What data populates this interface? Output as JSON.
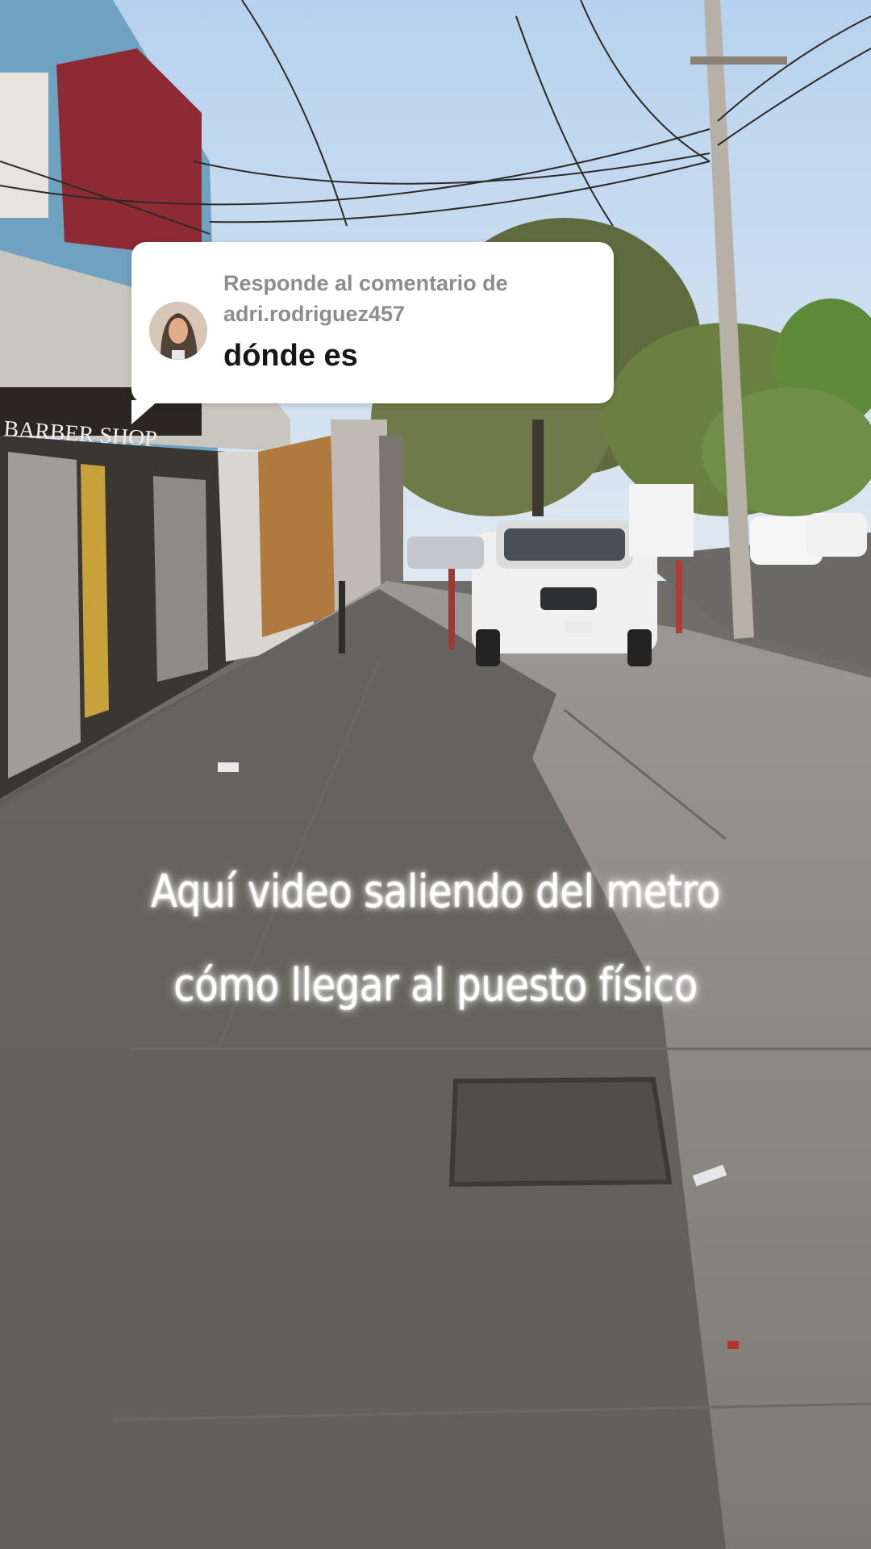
{
  "reply": {
    "header_line1": "Responde al comentario de",
    "header_line2": "adri.rodriguez457",
    "comment_text": "dónde es"
  },
  "caption": {
    "line1": "Aquí video saliendo del metro",
    "line2": "cómo llegar al puesto físico"
  },
  "scene": {
    "shop_sign": "BARBER SHOP"
  },
  "colors": {
    "sky": "#c9dcef",
    "sidewalk": "#8a8884",
    "shadow": "#595753",
    "bubble": "#ffffff",
    "caption_glow": "#ffffff"
  }
}
